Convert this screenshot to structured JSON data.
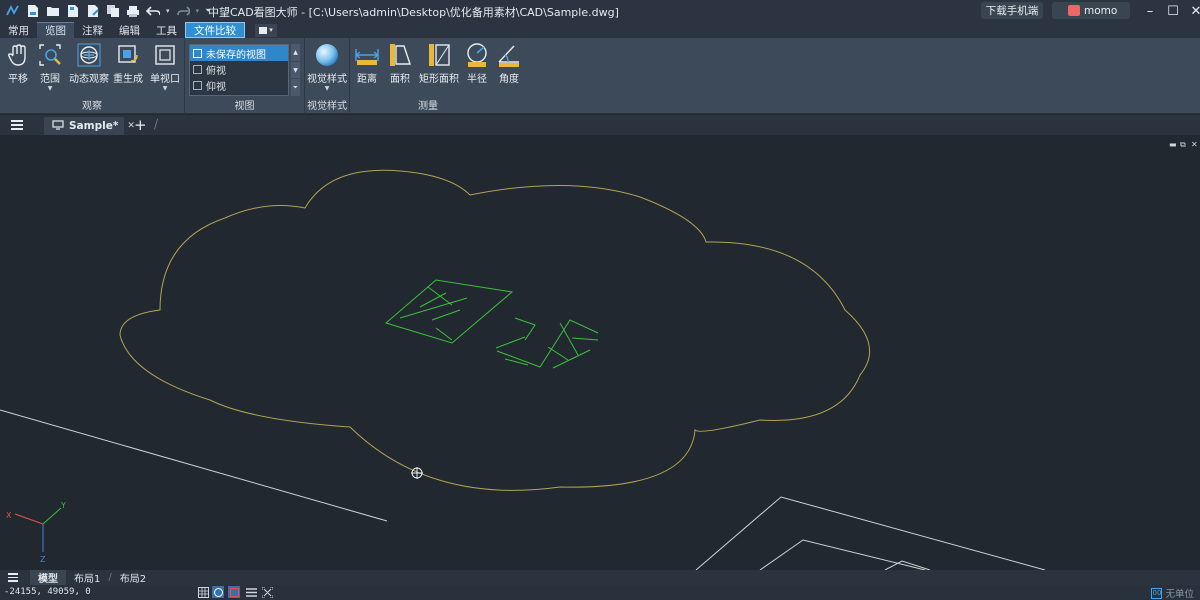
{
  "titlebar": {
    "title": "中望CAD看图大师 - [C:\\Users\\admin\\Desktop\\优化备用素材\\CAD\\Sample.dwg]",
    "download_label": "下载手机端",
    "user_name": "momo",
    "quick_access_icons": [
      "app-logo-icon",
      "new-file-icon",
      "open-folder-icon",
      "save-icon",
      "save-as-icon",
      "copy-icon",
      "print-icon",
      "undo-icon",
      "redo-icon",
      "customize-icon"
    ]
  },
  "menu": {
    "tabs": [
      "常用",
      "览图",
      "注释",
      "编辑",
      "工具",
      "文件比较"
    ],
    "active": "览图"
  },
  "ribbon": {
    "observe": {
      "label": "观察",
      "buttons": [
        "平移",
        "范围",
        "动态观察",
        "重生成",
        "单视口"
      ]
    },
    "views": {
      "label": "视图",
      "items": [
        "未保存的视图",
        "俯视",
        "仰视"
      ],
      "selected": "未保存的视图"
    },
    "visual_style": {
      "label": "视觉样式",
      "button": "视觉样式"
    },
    "measure": {
      "label": "测量",
      "buttons": [
        "距离",
        "面积",
        "矩形面积",
        "半径",
        "角度"
      ]
    }
  },
  "doc_tabs": [
    {
      "label": "Sample*"
    }
  ],
  "canvas": {
    "cloud_color": "#b5a255",
    "text_color": "#3cc03c",
    "line_color": "#d8d8d8",
    "ucs": {
      "x": "X",
      "y": "Y",
      "z": "Z"
    }
  },
  "layout_tabs": [
    "模型",
    "布局1",
    "布局2"
  ],
  "active_layout": "模型",
  "status": {
    "coords": "-24155, 49059, 0",
    "units": "无单位"
  }
}
